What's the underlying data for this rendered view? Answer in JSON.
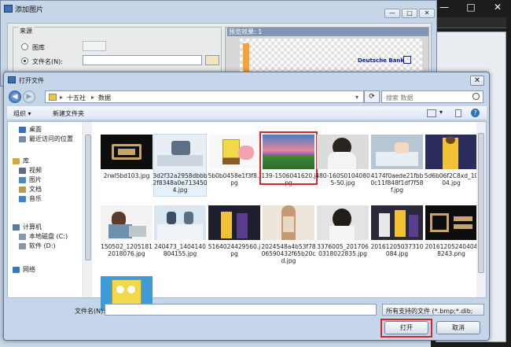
{
  "parent_dialog": {
    "title": "添加图片",
    "source_group": "来源",
    "radio_gallery": "图库",
    "radio_file": "文件名(N):",
    "preview_label": "预览效果: 1",
    "preview_brand": "Deutsche Bank"
  },
  "dialog": {
    "title": "打开文件",
    "close": "✕",
    "back": "◀",
    "forward": "▶",
    "breadcrumb": [
      "十五社",
      "数据"
    ],
    "search_placeholder": "搜索 数据",
    "toolbar": {
      "organize": "组织 ▾",
      "new_folder": "新建文件夹"
    },
    "nav": [
      {
        "label": "桌面",
        "color": "#3a6fb6"
      },
      {
        "label": "最近访问的位置",
        "color": "#7a8aa0"
      },
      {
        "label": "库",
        "color": "#d3a73a"
      },
      {
        "label": "视频",
        "color": "#5a6e8a"
      },
      {
        "label": "图片",
        "color": "#4c8bc2"
      },
      {
        "label": "文档",
        "color": "#b99a55"
      },
      {
        "label": "音乐",
        "color": "#3d84c9"
      },
      {
        "label": "计算机",
        "color": "#5b7aa5"
      },
      {
        "label": "本地磁盘 (C:)",
        "color": "#8797ab"
      },
      {
        "label": "软件 (D:)",
        "color": "#8797ab"
      },
      {
        "label": "网络",
        "color": "#3a79b8"
      }
    ],
    "files": [
      {
        "name": "2rwl5bd103.jpg",
        "img": "rng"
      },
      {
        "name": "3d2f32a2958dbbb2f8348a0e7134504.jpg",
        "img": "office"
      },
      {
        "name": "5b0b0458e1f3f8.jpg",
        "img": "sponge"
      },
      {
        "name": "139-1506041620.jpg",
        "img": "landscape"
      },
      {
        "name": "480-160S01040805-50.jpg",
        "img": "portrait"
      },
      {
        "name": "4174f0aede21fbb0c11f848f1df7f58f.jpg",
        "img": "desk"
      },
      {
        "name": "5d6b06f2C8xd_1004.jpg",
        "img": "kobe"
      },
      {
        "name": "150502_12051812018076.jpg",
        "img": "laptopgirl"
      },
      {
        "name": "240473_1404140804155.jpg",
        "img": "meeting"
      },
      {
        "name": "5164024429560.jpg",
        "img": "bball"
      },
      {
        "name": "2024548a4b53f7806590432f65b20cd.jpg",
        "img": "model"
      },
      {
        "name": "3376005_2017060318022835.jpg",
        "img": "girl2"
      },
      {
        "name": "20161205037310084.jpg",
        "img": "bball2"
      },
      {
        "name": "201612052404048243.png",
        "img": "rng2"
      },
      {
        "name": "",
        "img": "sponge2"
      }
    ],
    "filename_label": "文件名(N):",
    "filename_value": "",
    "filetype": "所有支持的文件 (*.bmp;*.dib;",
    "open_button": "打开",
    "cancel_button": "取消"
  },
  "bg_window": {
    "minimize": "—",
    "maximize": "□",
    "close": "✕"
  }
}
